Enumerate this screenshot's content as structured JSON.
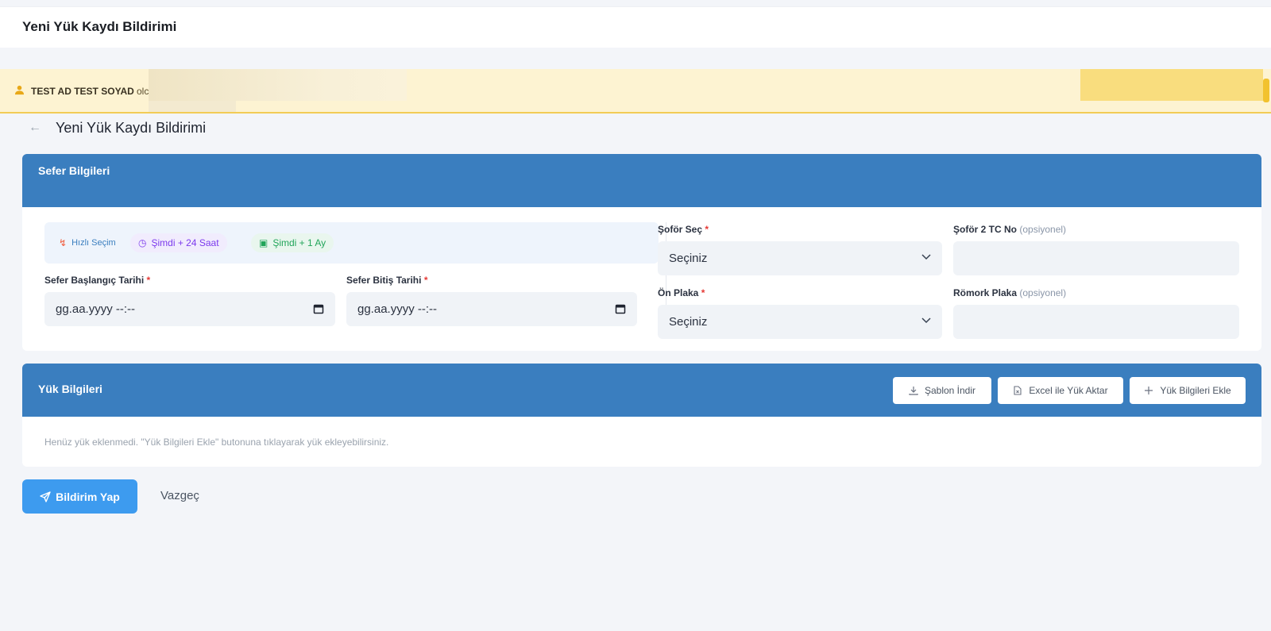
{
  "topbar": {
    "title": "Yeni Yük Kaydı Bildirimi"
  },
  "banner": {
    "user_name": "TEST AD TEST SOYAD",
    "rest_text": "olc"
  },
  "page": {
    "title": "Yeni Yük Kaydı Bildirimi"
  },
  "trip": {
    "section_title": "Sefer Bilgileri",
    "quick": {
      "fast_label": "Hızlı Seçim",
      "day_label": "Şimdi + 24 Saat",
      "month_label": "Şimdi + 1 Ay"
    },
    "start": {
      "label": "Sefer Başlangıç Tarihi",
      "required": "*",
      "placeholder": "gg.aa.yyyy --:--"
    },
    "end": {
      "label": "Sefer Bitiş Tarihi",
      "required": "*",
      "placeholder": "gg.aa.yyyy --:--"
    },
    "driver": {
      "label": "Şoför Seç",
      "required": "*",
      "value": "Seçiniz"
    },
    "driver2": {
      "label": "Şoför 2 TC No",
      "optional": "(opsiyonel)",
      "value": ""
    },
    "front_plate": {
      "label": "Ön Plaka",
      "required": "*",
      "value": "Seçiniz"
    },
    "trailer_plate": {
      "label": "Römork Plaka",
      "optional": "(opsiyonel)",
      "value": ""
    }
  },
  "load": {
    "section_title": "Yük Bilgileri",
    "template_btn": "Şablon İndir",
    "excel_btn": "Excel ile Yük Aktar",
    "add_btn": "Yük Bilgileri Ekle",
    "empty_msg": "Henüz yük eklenmedi. \"Yük Bilgileri Ekle\" butonuna tıklayarak yük ekleyebilirsiniz."
  },
  "actions": {
    "submit": "Bildirim Yap",
    "cancel": "Vazgeç"
  },
  "colors": {
    "primary": "#3a7ebf",
    "submit": "#3d9bef",
    "banner": "#fdf3d2",
    "required": "#e53935"
  }
}
